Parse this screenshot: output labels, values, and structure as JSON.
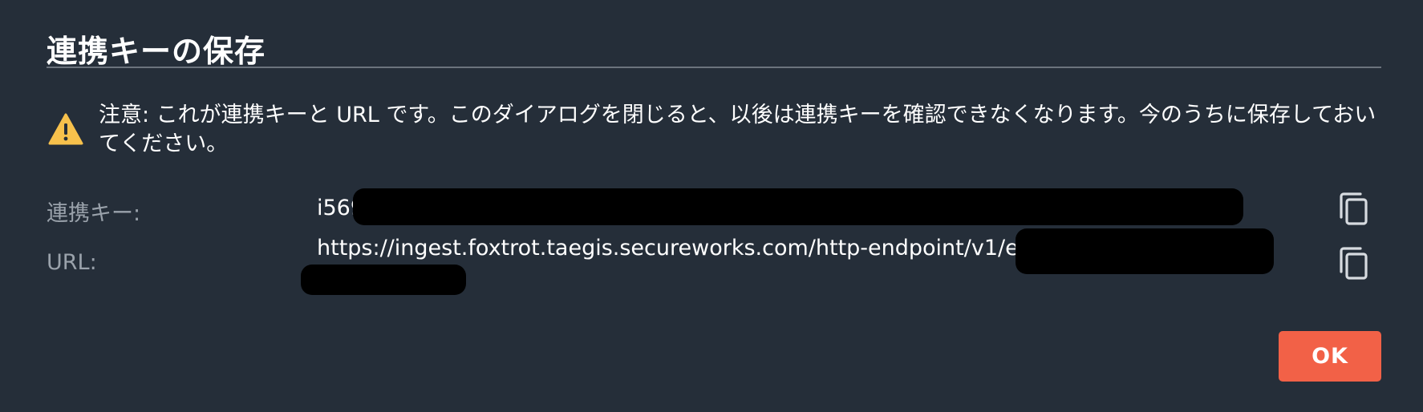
{
  "dialog": {
    "title": "連携キーの保存",
    "warning": {
      "icon": "warning-icon",
      "icon_color": "#f7c14c",
      "text": "注意: これが連携キーと URL です。このダイアログを閉じると、以後は連携キーを確認できなくなります。今のうちに保存しておいてください。"
    },
    "fields": {
      "key": {
        "label": "連携キー:",
        "value_visible": "i569",
        "copy_icon": "copy-icon"
      },
      "url": {
        "label": "URL:",
        "value_visible": "https://ingest.foxtrot.taegis.secureworks.com/http-endpoint/v1/e9",
        "copy_icon": "copy-icon"
      }
    },
    "ok_label": "OK",
    "colors": {
      "background": "#252e39",
      "accent": "#f26147",
      "label": "#9aa2ab"
    }
  }
}
